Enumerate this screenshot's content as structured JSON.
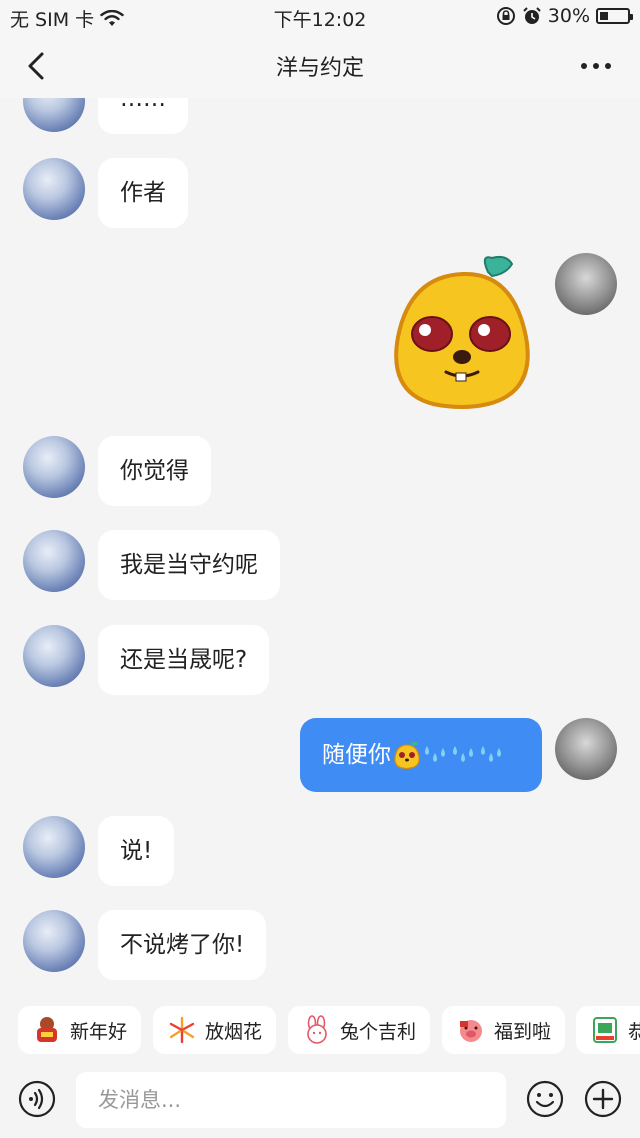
{
  "status": {
    "carrier": "无 SIM 卡",
    "time": "下午12:02",
    "battery_percent": "30%",
    "battery_level": 0.3
  },
  "header": {
    "title": "洋与约定",
    "back_icon": "chevron-left-icon",
    "more_icon": "more-icon"
  },
  "messages": [
    {
      "from": "other",
      "text": "……"
    },
    {
      "from": "other",
      "text": "作者"
    },
    {
      "from": "self",
      "sticker": "pear-sticker"
    },
    {
      "from": "other",
      "text": "你觉得"
    },
    {
      "from": "other",
      "text": "我是当守约呢"
    },
    {
      "from": "other",
      "text": "还是当晟呢?"
    },
    {
      "from": "self",
      "text": "随便你",
      "emoji": [
        "pear-emoji",
        "sweat-drops-emoji",
        "sweat-drops-emoji",
        "sweat-drops-emoji"
      ]
    },
    {
      "from": "other",
      "text": "说!"
    },
    {
      "from": "other",
      "text": "不说烤了你!"
    }
  ],
  "quick_replies": [
    {
      "label": "新年好",
      "icon": "lucky-bag-icon"
    },
    {
      "label": "放烟花",
      "icon": "fireworks-icon"
    },
    {
      "label": "兔个吉利",
      "icon": "rabbit-icon"
    },
    {
      "label": "福到啦",
      "icon": "lucky-pig-icon"
    },
    {
      "label": "恭",
      "icon": "mahjong-icon"
    }
  ],
  "composer": {
    "placeholder": "发消息...",
    "voice_icon": "voice-icon",
    "emoji_icon": "emoji-icon",
    "plus_icon": "plus-icon"
  },
  "colors": {
    "accent": "#3f8cf5",
    "background": "#f4f4f4"
  }
}
